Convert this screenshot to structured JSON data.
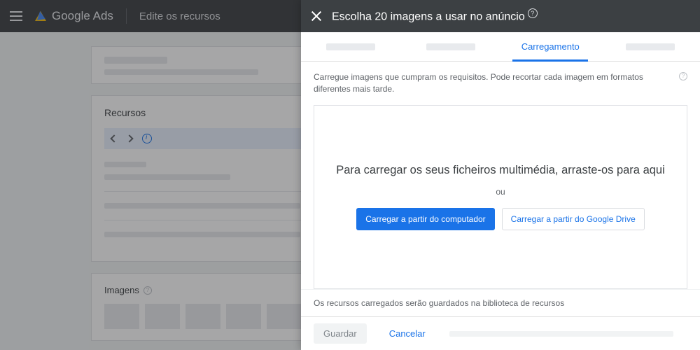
{
  "header": {
    "product": "Google Ads",
    "subtitle": "Edite os recursos"
  },
  "background": {
    "resources_title": "Recursos",
    "images_title": "Imagens"
  },
  "panel": {
    "title": "Escolha 20 imagens a usar no anúncio",
    "tabs": {
      "active_label": "Carregamento"
    },
    "instructions": "Carregue imagens que cumpram os requisitos. Pode recortar cada imagem em formatos diferentes mais tarde.",
    "dropzone": {
      "main": "Para carregar os seus ficheiros multimédia, arraste-os para aqui",
      "or": "ou",
      "btn_computer": "Carregar a partir do computador",
      "btn_drive": "Carregar a partir do Google Drive"
    },
    "note": "Os recursos carregados serão guardados na biblioteca de recursos",
    "footer": {
      "save": "Guardar",
      "cancel": "Cancelar"
    }
  }
}
